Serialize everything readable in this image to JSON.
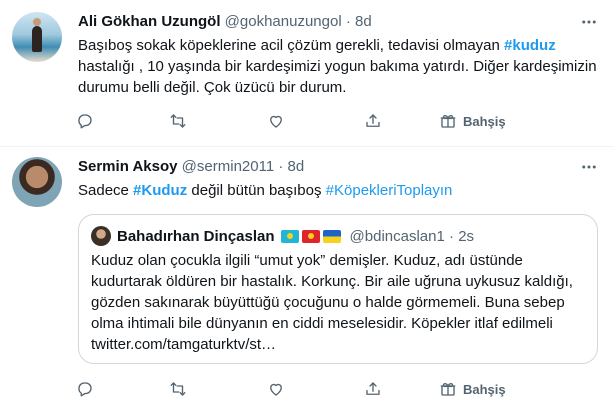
{
  "tweets": [
    {
      "author_name": "Ali Gökhan Uzungöl",
      "handle": "@gokhanuzungol",
      "separator": "·",
      "time": "8d",
      "text_parts": {
        "p1": "Başıboş sokak köpeklerine acil çözüm gerekli, tedavisi olmayan ",
        "tag1": "#kuduz",
        "p2": " hastalığı , 10 yaşında bir kardeşimizi yogun bakıma yatırdı. Diğer kardeşimizin durumu belli değil.  Çok üzücü bir durum."
      },
      "actions": {
        "tip_label": "Bahşiş"
      }
    },
    {
      "author_name": "Sermin Aksoy",
      "handle": "@sermin2011",
      "separator": "·",
      "time": "8d",
      "text_parts": {
        "p1": "Sadece ",
        "tag1": "#Kuduz",
        "p2": " değil bütün başıboş ",
        "tag2": "#KöpekleriToplayın"
      },
      "quote": {
        "author_name": "Bahadırhan Dinçaslan",
        "handle": "@bdincaslan1",
        "separator": "·",
        "time": "2s",
        "text": "Kuduz olan çocukla ilgili “umut yok” demişler. Kuduz, adı üstünde kudurtarak öldüren bir hastalık. Korkunç. Bir aile uğruna uykusuz kaldığı, gözden sakınarak büyüttüğü çocuğunu o halde görmemeli. Buna sebep olma ihtimali bile dünyanın en ciddi meselesidir. Köpekler itlaf edilmeli twitter.com/tamgaturktv/st…"
      },
      "actions": {
        "tip_label": "Bahşiş"
      }
    }
  ],
  "colors": {
    "link": "#1d9bf0",
    "secondary_text": "#536471",
    "border": "#cfd9de"
  },
  "icons": [
    "more-icon",
    "reply-icon",
    "retweet-icon",
    "like-icon",
    "share-icon",
    "tip-icon"
  ]
}
